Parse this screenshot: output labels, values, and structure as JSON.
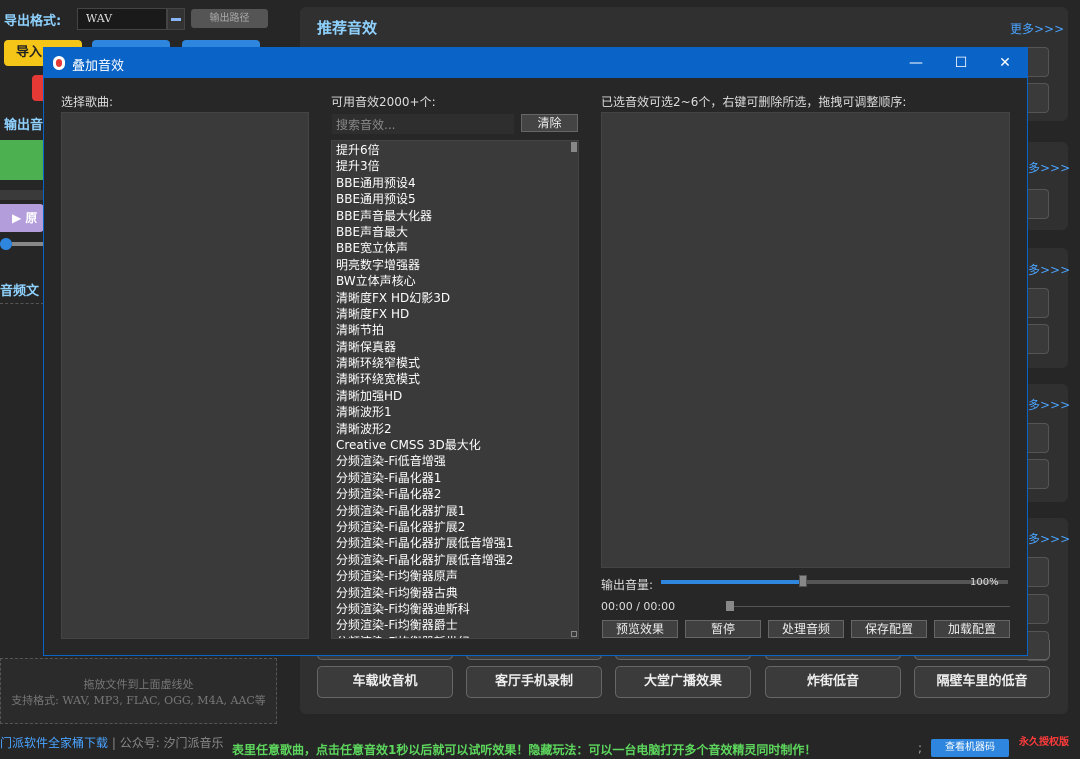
{
  "app": {
    "format_label": "导出格式:",
    "format_value": "WAV",
    "export_path_button": "输出路径",
    "import_button": "导入",
    "export_audio_label": "输出音",
    "preview_button": "▶ 原",
    "audio_files_label": "音频文",
    "drop_hint": "拖放文件到上面虚线处",
    "supported_formats": "支持格式: WAV, MP3, FLAC, OGG, M4A, AAC等",
    "footer_link": "门派软件全家桶下载",
    "footer_sep": " | ",
    "footer_wechat": "公众号: 汐门派音乐",
    "footer_tip": "表里任意歌曲，点击任意音效1秒以后就可以试听效果！隐藏玩法：可以一台电脑打开多个音效精灵同时制作！",
    "footer_colon": ";",
    "machine_code_button": "查看机器码",
    "permanent_license": "永久授权版"
  },
  "recommend": {
    "title": "推荐音效",
    "more": "更多>>>",
    "more_short": "多>>>",
    "bottom_buttons": [
      "车载收音机",
      "客厅手机录制",
      "大堂广播效果",
      "炸街低音",
      "隔壁车里的低音"
    ]
  },
  "dialog": {
    "title": "叠加音效",
    "controls": {
      "minimize": "—",
      "maximize": "☐",
      "close": "✕"
    },
    "songs_label": "选择歌曲:",
    "effects_label": "可用音效2000+个:",
    "search_placeholder": "搜索音效...",
    "clear_button": "清除",
    "selected_label": "已选音效可选2~6个，右键可删除所选，拖拽可调整顺序:",
    "effects": [
      "提升6倍",
      "提升3倍",
      "BBE通用预设4",
      "BBE通用预设5",
      "BBE声音最大化器",
      "BBE声音最大",
      "BBE宽立体声",
      "明亮数字增强器",
      "BW立体声核心",
      "清晰度FX HD幻影3D",
      "清晰度FX HD",
      "清晰节拍",
      "清晰保真器",
      "清晰环绕窄模式",
      "清晰环绕宽模式",
      "清晰加强HD",
      "清晰波形1",
      "清晰波形2",
      "Creative CMSS 3D最大化",
      "分频渲染-Fi低音增强",
      "分频渲染-Fi晶化器1",
      "分频渲染-Fi晶化器2",
      "分频渲染-Fi晶化器扩展1",
      "分频渲染-Fi晶化器扩展2",
      "分频渲染-Fi晶化器扩展低音增强1",
      "分频渲染-Fi晶化器扩展低音增强2",
      "分频渲染-Fi均衡器原声",
      "分频渲染-Fi均衡器古典",
      "分频渲染-Fi均衡器迪斯科",
      "分频渲染-Fi均衡器爵士",
      "分频渲染-Fi均衡器新世纪"
    ],
    "volume_label": "输出音量:",
    "volume_value": 0.41,
    "volume_percent": "100%",
    "time": "00:00 / 00:00",
    "buttons": [
      "预览效果",
      "暂停",
      "处理音频",
      "保存配置",
      "加载配置"
    ]
  }
}
